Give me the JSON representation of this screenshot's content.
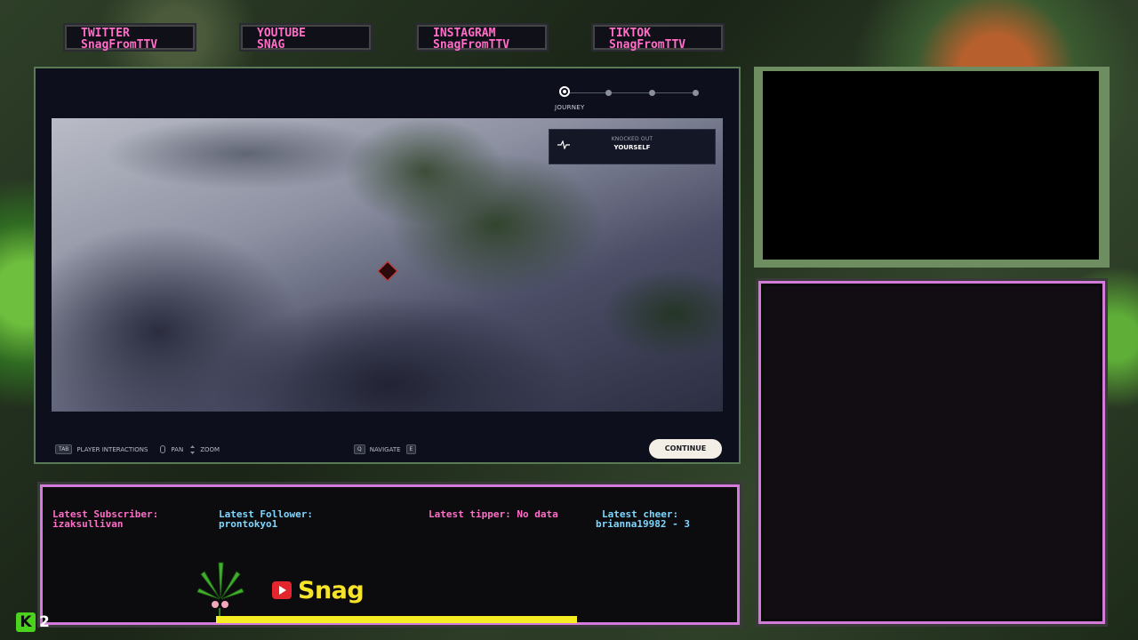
{
  "socials": [
    {
      "network": "TWITTER",
      "handle": "SnagFromTTV"
    },
    {
      "network": "YOUTUBE",
      "handle": "SNAG"
    },
    {
      "network": "INSTAGRAM",
      "handle": "SnagFromTTV"
    },
    {
      "network": "TIKTOK",
      "handle": "SnagFromTTV"
    }
  ],
  "game": {
    "journey_label": "JOURNEY",
    "journey_steps": 4,
    "journey_current_step": 1,
    "status": {
      "title": "KNOCKED OUT",
      "subject": "YOURSELF"
    },
    "hints": [
      {
        "key": "TAB",
        "label": "PLAYER INTERACTIONS"
      },
      {
        "key": "mouse-icon",
        "label": "PAN"
      },
      {
        "key": "scroll-icon",
        "label": "ZOOM"
      }
    ],
    "navigate": {
      "key_left": "Q",
      "label": "NAVIGATE",
      "key_right": "E"
    },
    "continue_label": "CONTINUE"
  },
  "overlay": {
    "latest_subscriber": {
      "label": "Latest Subscriber:",
      "value": "izaksullivan"
    },
    "latest_follower": {
      "label": "Latest Follower:",
      "value": "prontokyo1"
    },
    "latest_tipper": {
      "label": "Latest tipper: No data",
      "value": ""
    },
    "latest_cheer": {
      "label": "Latest cheer:",
      "value": "brianna19982 - 3"
    },
    "streamer_name": "Snag",
    "goal_progress": 0.52,
    "kick_label": "K",
    "kick_count": "2"
  },
  "colors": {
    "accent_pink": "#ff6ec7",
    "accent_blue": "#7fd7ff",
    "frame_pink": "#d27bd8",
    "progress_yellow": "#f6ee23",
    "kick_green": "#4bd21d"
  }
}
